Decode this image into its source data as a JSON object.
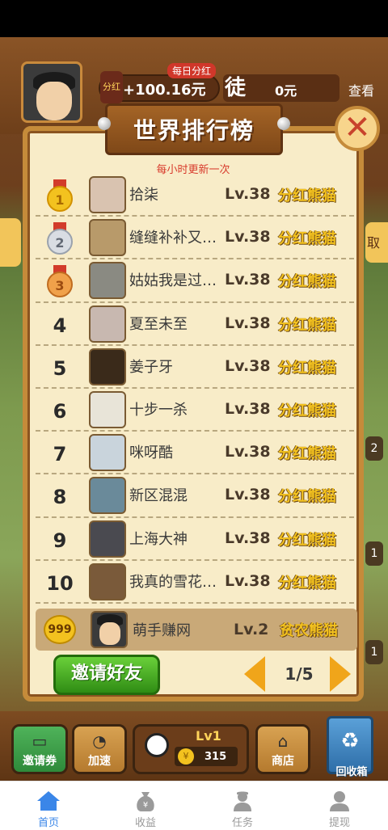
{
  "hud": {
    "daily_dividend_tag": "每日分红",
    "money_icon_label": "分红",
    "money_value": "+100.16元",
    "apprentice_label": "徒",
    "apprentice_value": "0元",
    "view_link": "查看",
    "side_right_label": "取"
  },
  "side_numbers": [
    "2",
    "1",
    "1"
  ],
  "modal": {
    "title": "世界排行榜",
    "subtitle": "每小时更新一次",
    "close_symbol": "✕"
  },
  "ranking": [
    {
      "rank": "1",
      "name": "拾柒",
      "level": "Lv.38",
      "title": "分红熊猫",
      "photo_color": "#d9c3b0"
    },
    {
      "rank": "2",
      "name": "缝缝补补又…",
      "level": "Lv.38",
      "title": "分红熊猫",
      "photo_color": "#b89a6a"
    },
    {
      "rank": "3",
      "name": "姑姑我是过…",
      "level": "Lv.38",
      "title": "分红熊猫",
      "photo_color": "#8a8a82"
    },
    {
      "rank": "4",
      "name": "夏至未至",
      "level": "Lv.38",
      "title": "分红熊猫",
      "photo_color": "#c8b8b0"
    },
    {
      "rank": "5",
      "name": "姜子牙",
      "level": "Lv.38",
      "title": "分红熊猫",
      "photo_color": "#3a2a1a"
    },
    {
      "rank": "6",
      "name": "十步一杀",
      "level": "Lv.38",
      "title": "分红熊猫",
      "photo_color": "#e8e4d8"
    },
    {
      "rank": "7",
      "name": "咪呀酷",
      "level": "Lv.38",
      "title": "分红熊猫",
      "photo_color": "#c9d4dc"
    },
    {
      "rank": "8",
      "name": "新区混混",
      "level": "Lv.38",
      "title": "分红熊猫",
      "photo_color": "#6a8a9a"
    },
    {
      "rank": "9",
      "name": "上海大神",
      "level": "Lv.38",
      "title": "分红熊猫",
      "photo_color": "#4a4a50"
    },
    {
      "rank": "10",
      "name": "我真的雪花…",
      "level": "Lv.38",
      "title": "分红熊猫",
      "photo_color": "#7a5a3a"
    }
  ],
  "my_rank": {
    "badge": "999",
    "name": "萌手赚网",
    "level": "Lv.2",
    "title": "贫农熊猫"
  },
  "invite_button": "邀请好友",
  "pager": {
    "text": "1/5"
  },
  "game_bar": {
    "coupon_label": "邀请券",
    "speed_label": "加速",
    "panda_level": "Lv1",
    "panda_coins": "315",
    "shop_label": "商店",
    "recycle_label": "回收箱"
  },
  "tabs": [
    {
      "label": "首页",
      "active": true
    },
    {
      "label": "收益",
      "active": false
    },
    {
      "label": "任务",
      "active": false
    },
    {
      "label": "提现",
      "active": false
    }
  ],
  "colors": {
    "accent_blue": "#3a86e8",
    "title_gold": "#f3c21f",
    "invite_green": "#3fa81f",
    "modal_bg": "#f8ecc8"
  }
}
